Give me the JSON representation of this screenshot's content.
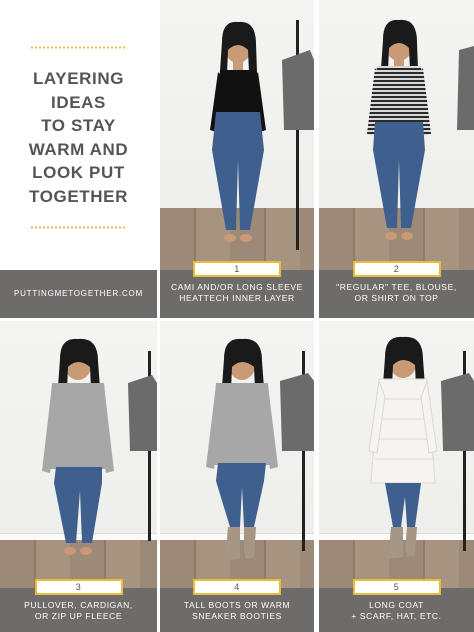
{
  "title_lines": [
    "LAYERING",
    "IDEAS",
    "TO STAY",
    "WARM AND",
    "LOOK PUT",
    "TOGETHER"
  ],
  "website": "PUTTINGMETOGETHER.COM",
  "steps": [
    {
      "number": "1",
      "line1": "CAMI AND/OR LONG SLEEVE",
      "line2": "HEATTECH INNER LAYER"
    },
    {
      "number": "2",
      "line1": "\"REGULAR\" TEE, BLOUSE,",
      "line2": "OR SHIRT ON TOP"
    },
    {
      "number": "3",
      "line1": "PULLOVER, CARDIGAN,",
      "line2": "OR ZIP UP FLEECE"
    },
    {
      "number": "4",
      "line1": "TALL BOOTS OR WARM",
      "line2": "SNEAKER BOOTIES"
    },
    {
      "number": "5",
      "line1": "LONG COAT",
      "line2": "+ SCARF, HAT, ETC."
    }
  ],
  "colors": {
    "accent_gold": "#e8bd3a",
    "caption_gray": "#6e6b6b",
    "title_gray": "#555555"
  }
}
